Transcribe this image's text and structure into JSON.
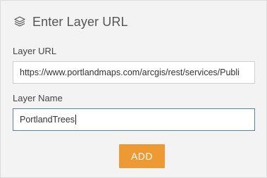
{
  "header": {
    "title": "Enter Layer URL",
    "icon": "layers-icon"
  },
  "form": {
    "url_label": "Layer URL",
    "url_value": "https://www.portlandmaps.com/arcgis/rest/services/Publi",
    "name_label": "Layer Name",
    "name_value": "PortlandTrees"
  },
  "actions": {
    "add_label": "ADD",
    "add_color": "#ee9a34"
  }
}
